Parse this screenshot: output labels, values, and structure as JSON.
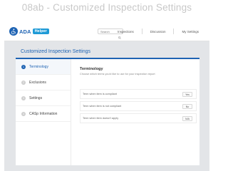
{
  "frame": {
    "title": "08ab - Customized Inspection Settings"
  },
  "app": {
    "logo_text": "ADA",
    "logo_badge": "Helper",
    "search": {
      "placeholder": "Search",
      "value": ""
    },
    "nav": [
      {
        "label": "Inspections"
      },
      {
        "label": "Discussion"
      },
      {
        "label": "My Settings"
      }
    ]
  },
  "page": {
    "title": "Customized Inspection Settings"
  },
  "sidebar": {
    "items": [
      {
        "num": "1",
        "label": "Terminology",
        "active": true
      },
      {
        "num": "2",
        "label": "Exclusions",
        "active": false
      },
      {
        "num": "3",
        "label": "Settings",
        "active": false
      },
      {
        "num": "4",
        "label": "CASp Information",
        "active": false
      }
    ]
  },
  "terminology": {
    "title": "Terminology",
    "subtitle": "Choose which terms you'd like to use for your inspection report",
    "rows": [
      {
        "label": "Term when item is compliant",
        "value": "Yes"
      },
      {
        "label": "Term when item is not compliant",
        "value": "No"
      },
      {
        "label": "Term when item doesn't apply",
        "value": "N/A"
      }
    ]
  }
}
